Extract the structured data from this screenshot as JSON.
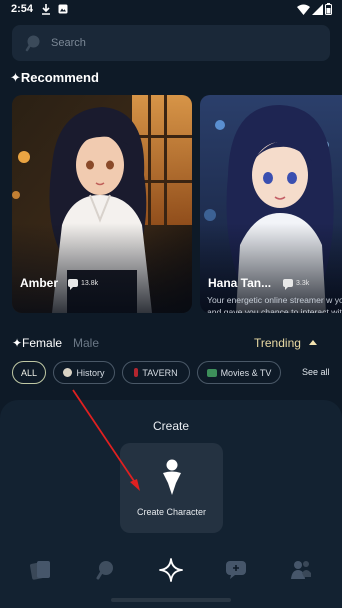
{
  "status_bar": {
    "time": "2:54"
  },
  "search": {
    "placeholder": "Search"
  },
  "recommend": {
    "title": "✦Recommend",
    "cards": [
      {
        "name": "Amber",
        "chats": "13.8k",
        "description": ""
      },
      {
        "name": "Hana Tan...",
        "chats": "3.3k",
        "description": "Your energetic online streamer w your loyal support and gave you chance to interact with her, wou"
      }
    ]
  },
  "filters": {
    "female": "✦Female",
    "male": "Male",
    "sort": "Trending",
    "chips": [
      "ALL",
      "History",
      "TAVERN",
      "Movies & TV"
    ],
    "see_all": "See all"
  },
  "create": {
    "title": "Create",
    "option_label": "Create Character"
  },
  "colors": {
    "background": "#0e1a27",
    "panel": "#132231",
    "accent_gold": "#e8d9a3",
    "arrow_annotation": "#e02020"
  }
}
